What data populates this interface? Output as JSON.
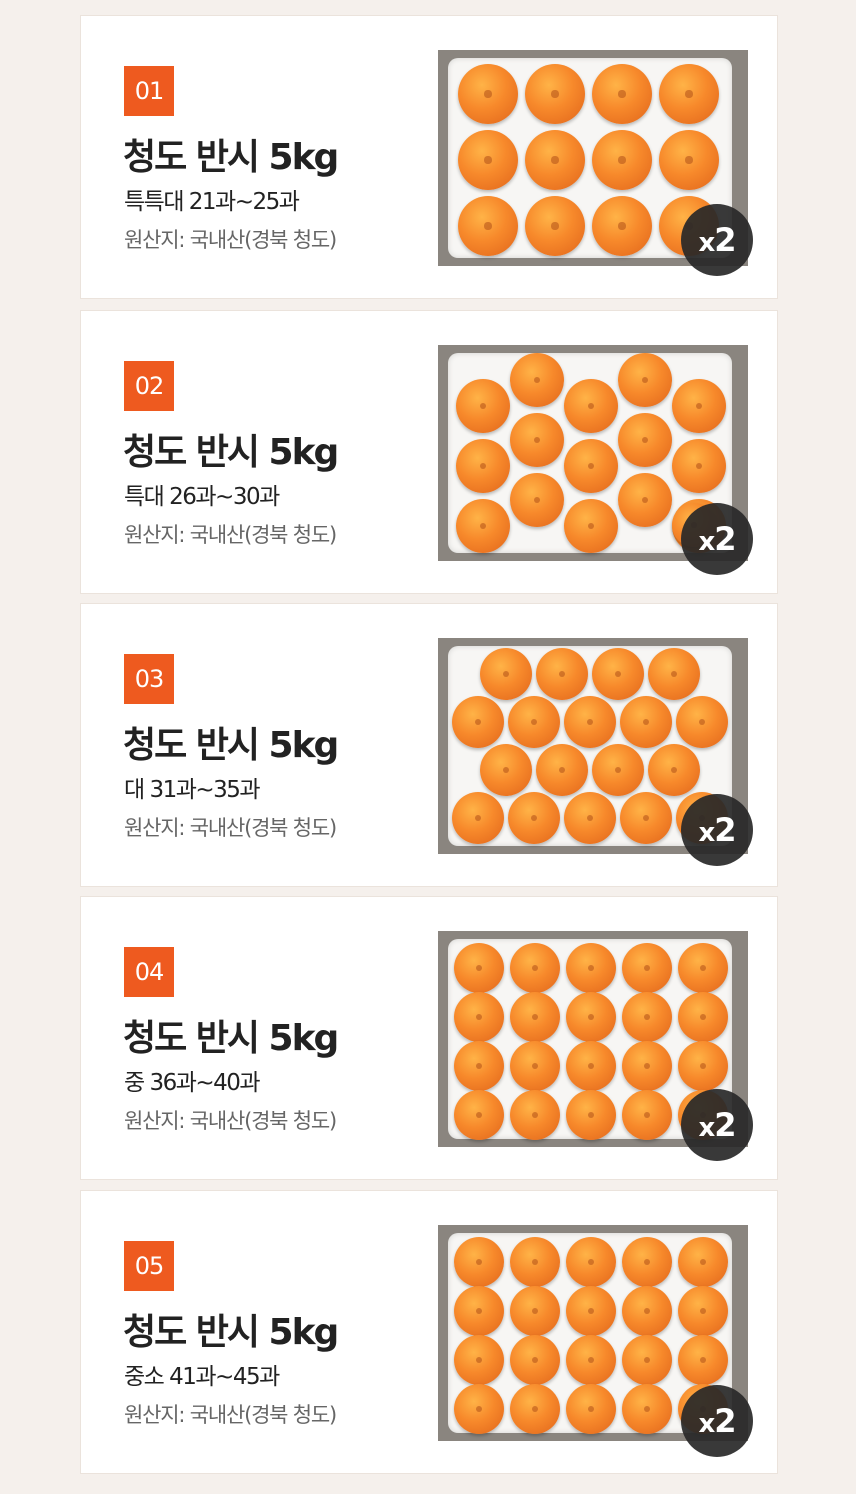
{
  "products": [
    {
      "number": "01",
      "title": "청도 반시 5kg",
      "grade": "특특대 21과~25과",
      "origin": "원산지: 국내산(경북 청도)",
      "qty_x": "x",
      "qty_n": "2",
      "image": "persimmon-box-photo",
      "layout": "4x3"
    },
    {
      "number": "02",
      "title": "청도 반시 5kg",
      "grade": "특대 26과~30과",
      "origin": "원산지: 국내산(경북 청도)",
      "qty_x": "x",
      "qty_n": "2",
      "image": "persimmon-box-photo",
      "layout": "stagger5"
    },
    {
      "number": "03",
      "title": "청도 반시 5kg",
      "grade": "대 31과~35과",
      "origin": "원산지: 국내산(경북 청도)",
      "qty_x": "x",
      "qty_n": "2",
      "image": "persimmon-box-photo",
      "layout": "stagger4"
    },
    {
      "number": "04",
      "title": "청도 반시 5kg",
      "grade": "중 36과~40과",
      "origin": "원산지: 국내산(경북 청도)",
      "qty_x": "x",
      "qty_n": "2",
      "image": "persimmon-box-photo",
      "layout": "5x4"
    },
    {
      "number": "05",
      "title": "청도 반시 5kg",
      "grade": "중소 41과~45과",
      "origin": "원산지: 국내산(경북 청도)",
      "qty_x": "x",
      "qty_n": "2",
      "image": "persimmon-box-photo",
      "layout": "5x4"
    }
  ],
  "colors": {
    "accent": "#ee5a1f",
    "background": "#f5f0ec",
    "card": "#ffffff",
    "badge": "#282828"
  }
}
